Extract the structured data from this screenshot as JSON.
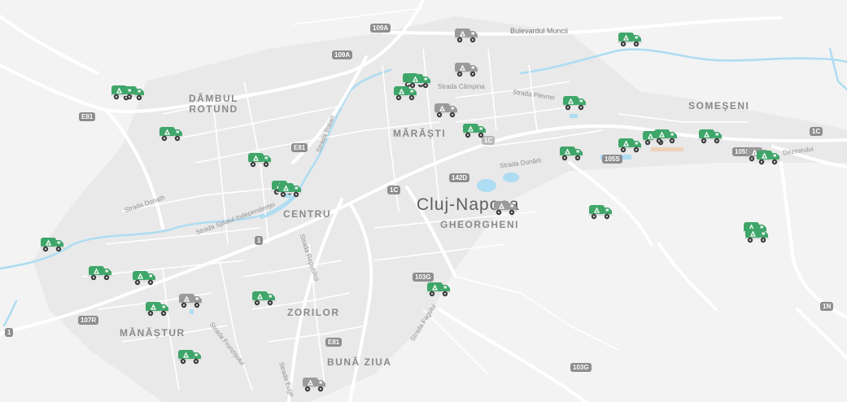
{
  "districts": {
    "dambul_rotund_line1": "DÂMBUL",
    "dambul_rotund_line2": "ROTUND",
    "marasti": "MĂRĂȘTI",
    "someseni": "SOMEȘENI",
    "centru": "CENTRU",
    "gheorgheni": "GHEORGHENI",
    "zorilor": "ZORILOR",
    "manastur": "MĂNĂȘTUR",
    "buna_ziua": "BUNĂ ZIUA"
  },
  "city": "Cluj-Napoca",
  "streets": {
    "bulevardul_muncii": "Bulevardul Muncii",
    "campina": "Strada Câmpina",
    "plevnei": "Strada Plevnei",
    "dunarii": "Strada Dunării",
    "donath": "Strada Donath",
    "splaiul": "Strada Splaiul Independenței",
    "traian": "Strada Traian",
    "republicii": "Strada Republicii",
    "fagului": "Strada Fagului",
    "frunzisului": "Strada Frunzișului",
    "eugen": "Strada Euge",
    "dezmirului": "Dezmirului"
  },
  "shields": {
    "r109a_top": "109A",
    "r109a": "109A",
    "e81_west": "E81",
    "e81_center": "E81",
    "e81_south": "E81",
    "r1c_center": "1C",
    "r1c_marasti": "1C",
    "r1c_east": "1C",
    "r142d": "142D",
    "r105s": "105S",
    "r105s_east": "105S",
    "r1_center": "1",
    "r1_west": "1",
    "r103g": "103G",
    "r103g_south": "103G",
    "r107r": "107R",
    "r1n": "1N"
  },
  "trucks": {
    "active_color": "#3fa66a",
    "inactive_color": "#9a9a9a",
    "active_count": 28,
    "inactive_count": 7
  }
}
